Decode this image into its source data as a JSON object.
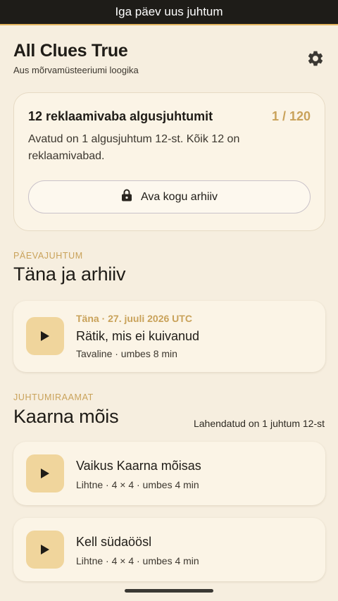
{
  "banner": {
    "text": "Iga päev uus juhtum"
  },
  "header": {
    "title": "All Clues True",
    "subtitle": "Aus mõrvamüsteeriumi loogika",
    "settings_icon": "gear-icon"
  },
  "promo": {
    "title": "12 reklaamivaba algusjuhtumit",
    "count": "1 / 120",
    "description": "Avatud on 1 algusjuhtum 12-st. Kõik 12 on reklaamivabad.",
    "button_label": "Ava kogu arhiiv",
    "button_icon": "lock-icon"
  },
  "daily": {
    "overline": "PÄEVAJUHTUM",
    "title": "Täna ja arhiiv",
    "card": {
      "date": "Täna · 27. juuli 2026 UTC",
      "title": "Rätik, mis ei kuivanud",
      "meta": "Tavaline · umbes 8 min"
    }
  },
  "casebook": {
    "overline": "JUHTUMIRAAMAT",
    "title": "Kaarna mõis",
    "progress": "Lahendatud on 1 juhtum 12-st",
    "cases": [
      {
        "title": "Vaikus Kaarna mõisas",
        "meta": "Lihtne · 4 × 4 · umbes 4 min"
      },
      {
        "title": "Kell südaöösl",
        "meta": "Lihtne · 4 × 4 · umbes 4 min"
      }
    ]
  },
  "colors": {
    "background": "#f6eedf",
    "accent": "#c9a25a",
    "play_tile": "#f0d59c",
    "banner": "#1e1c18"
  }
}
